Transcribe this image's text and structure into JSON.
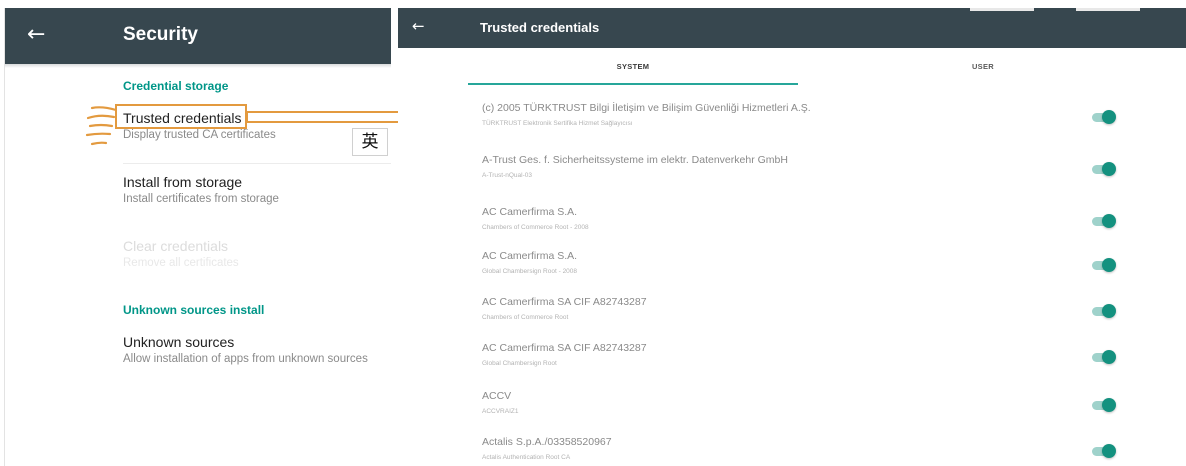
{
  "security": {
    "title": "Security",
    "credential_storage_header": "Credential storage",
    "trusted_credentials_title": "Trusted credentials",
    "trusted_credentials_summary": "Display trusted CA certificates",
    "install_title": "Install from storage",
    "install_summary": "Install certificates from storage",
    "clear_title": "Clear credentials",
    "clear_summary": "Remove all certificates",
    "unknown_header": "Unknown sources install",
    "unknown_title": "Unknown sources",
    "unknown_summary": "Allow installation of apps from unknown sources"
  },
  "ime_badge": "英",
  "trusted": {
    "title": "Trusted credentials",
    "tabs": [
      {
        "label": "SYSTEM",
        "active": true
      },
      {
        "label": "USER",
        "active": false
      }
    ],
    "certs": [
      {
        "name": "(c) 2005 TÜRKTRUST Bilgi İletişim ve Bilişim Güvenliği Hizmetleri A.Ş.",
        "sub": "TÜRKTRUST Elektronik Sertifika Hizmet Sağlayıcısı",
        "enabled": true
      },
      {
        "name": "A-Trust Ges. f. Sicherheitssysteme im elektr. Datenverkehr GmbH",
        "sub": "A-Trust-nQual-03",
        "enabled": true
      },
      {
        "name": "AC Camerfirma S.A.",
        "sub": "Chambers of Commerce Root - 2008",
        "enabled": true
      },
      {
        "name": "AC Camerfirma S.A.",
        "sub": "Global Chambersign Root - 2008",
        "enabled": true
      },
      {
        "name": "AC Camerfirma SA CIF A82743287",
        "sub": "Chambers of Commerce Root",
        "enabled": true
      },
      {
        "name": "AC Camerfirma SA CIF A82743287",
        "sub": "Global Chambersign Root",
        "enabled": true
      },
      {
        "name": "ACCV",
        "sub": "ACCVRAIZ1",
        "enabled": true
      },
      {
        "name": "Actalis S.p.A./03358520967",
        "sub": "Actalis Authentication Root CA",
        "enabled": true
      }
    ]
  },
  "colors": {
    "toolbar": "#37474f",
    "accent": "#009688",
    "switch_thumb": "#14917f",
    "annotation": "#e39a3f"
  },
  "icons": {
    "back": "arrow-left-icon",
    "pointer": "pointing-hand-icon",
    "callout": "arrow-right-icon"
  }
}
